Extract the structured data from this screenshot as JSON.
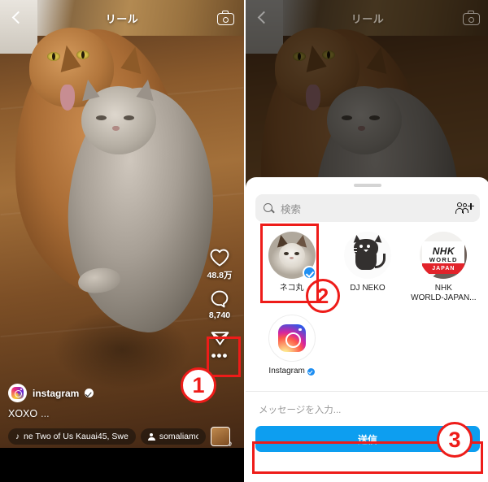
{
  "app": {
    "topbar": {
      "title": "リール",
      "back_icon": "back-arrow-icon",
      "camera_icon": "camera-icon"
    }
  },
  "reel": {
    "actions": {
      "like": {
        "icon": "heart-icon",
        "count": "48.8万"
      },
      "comment": {
        "icon": "comment-bubble-icon",
        "count": "8,740"
      },
      "share": {
        "icon": "share-paper-plane-icon"
      },
      "more": {
        "icon": "more-dots-icon",
        "label": "•••"
      }
    },
    "caption": {
      "username": "instagram",
      "verified": true,
      "text": "XOXO",
      "ellipsis": "...",
      "music_pill": "ne Two of Us   Kauai45, Swe",
      "music_icon": "music-note-icon",
      "user_pill": "somaliamo",
      "user_icon": "person-icon",
      "audio_thumb": "audio-thumbnail-icon"
    }
  },
  "share_sheet": {
    "grabber": "drag-handle",
    "search": {
      "placeholder": "検索",
      "icon": "search-icon",
      "add_people_icon": "add-people-icon"
    },
    "contacts": [
      {
        "name": "ネコ丸",
        "avatar": "cat-photo-avatar",
        "selected": true,
        "verified": false,
        "highlighted": true
      },
      {
        "name": "DJ NEKO",
        "avatar": "black-cat-avatar",
        "selected": false,
        "verified": false,
        "highlighted": false
      },
      {
        "name": "NHK\nWORLD-JAPAN...",
        "avatar": "nhk-world-japan-logo",
        "selected": false,
        "verified": false,
        "highlighted": false
      },
      {
        "name": "Instagram",
        "avatar": "instagram-logo",
        "selected": false,
        "verified": true,
        "highlighted": false
      }
    ],
    "contact_labels": {
      "nekomaru": "ネコ丸",
      "djneko": "DJ NEKO",
      "nhk_line1": "NHK",
      "nhk_line2": "WORLD-JAPAN...",
      "instagram": "Instagram"
    },
    "nhk_logo": {
      "line1": "NHK",
      "line2": "WORLD",
      "line3": "JAPAN"
    },
    "message_placeholder": "メッセージを入力...",
    "send_button": "送信"
  },
  "annotations": {
    "step1": "1",
    "step2": "2",
    "step3": "3",
    "highlight_color": "#ee1c19"
  },
  "colors": {
    "send_blue": "#0d9ef0",
    "verified_blue": "#1f8ff2",
    "sheet_bg": "#ffffff",
    "search_bg": "#efefef"
  }
}
